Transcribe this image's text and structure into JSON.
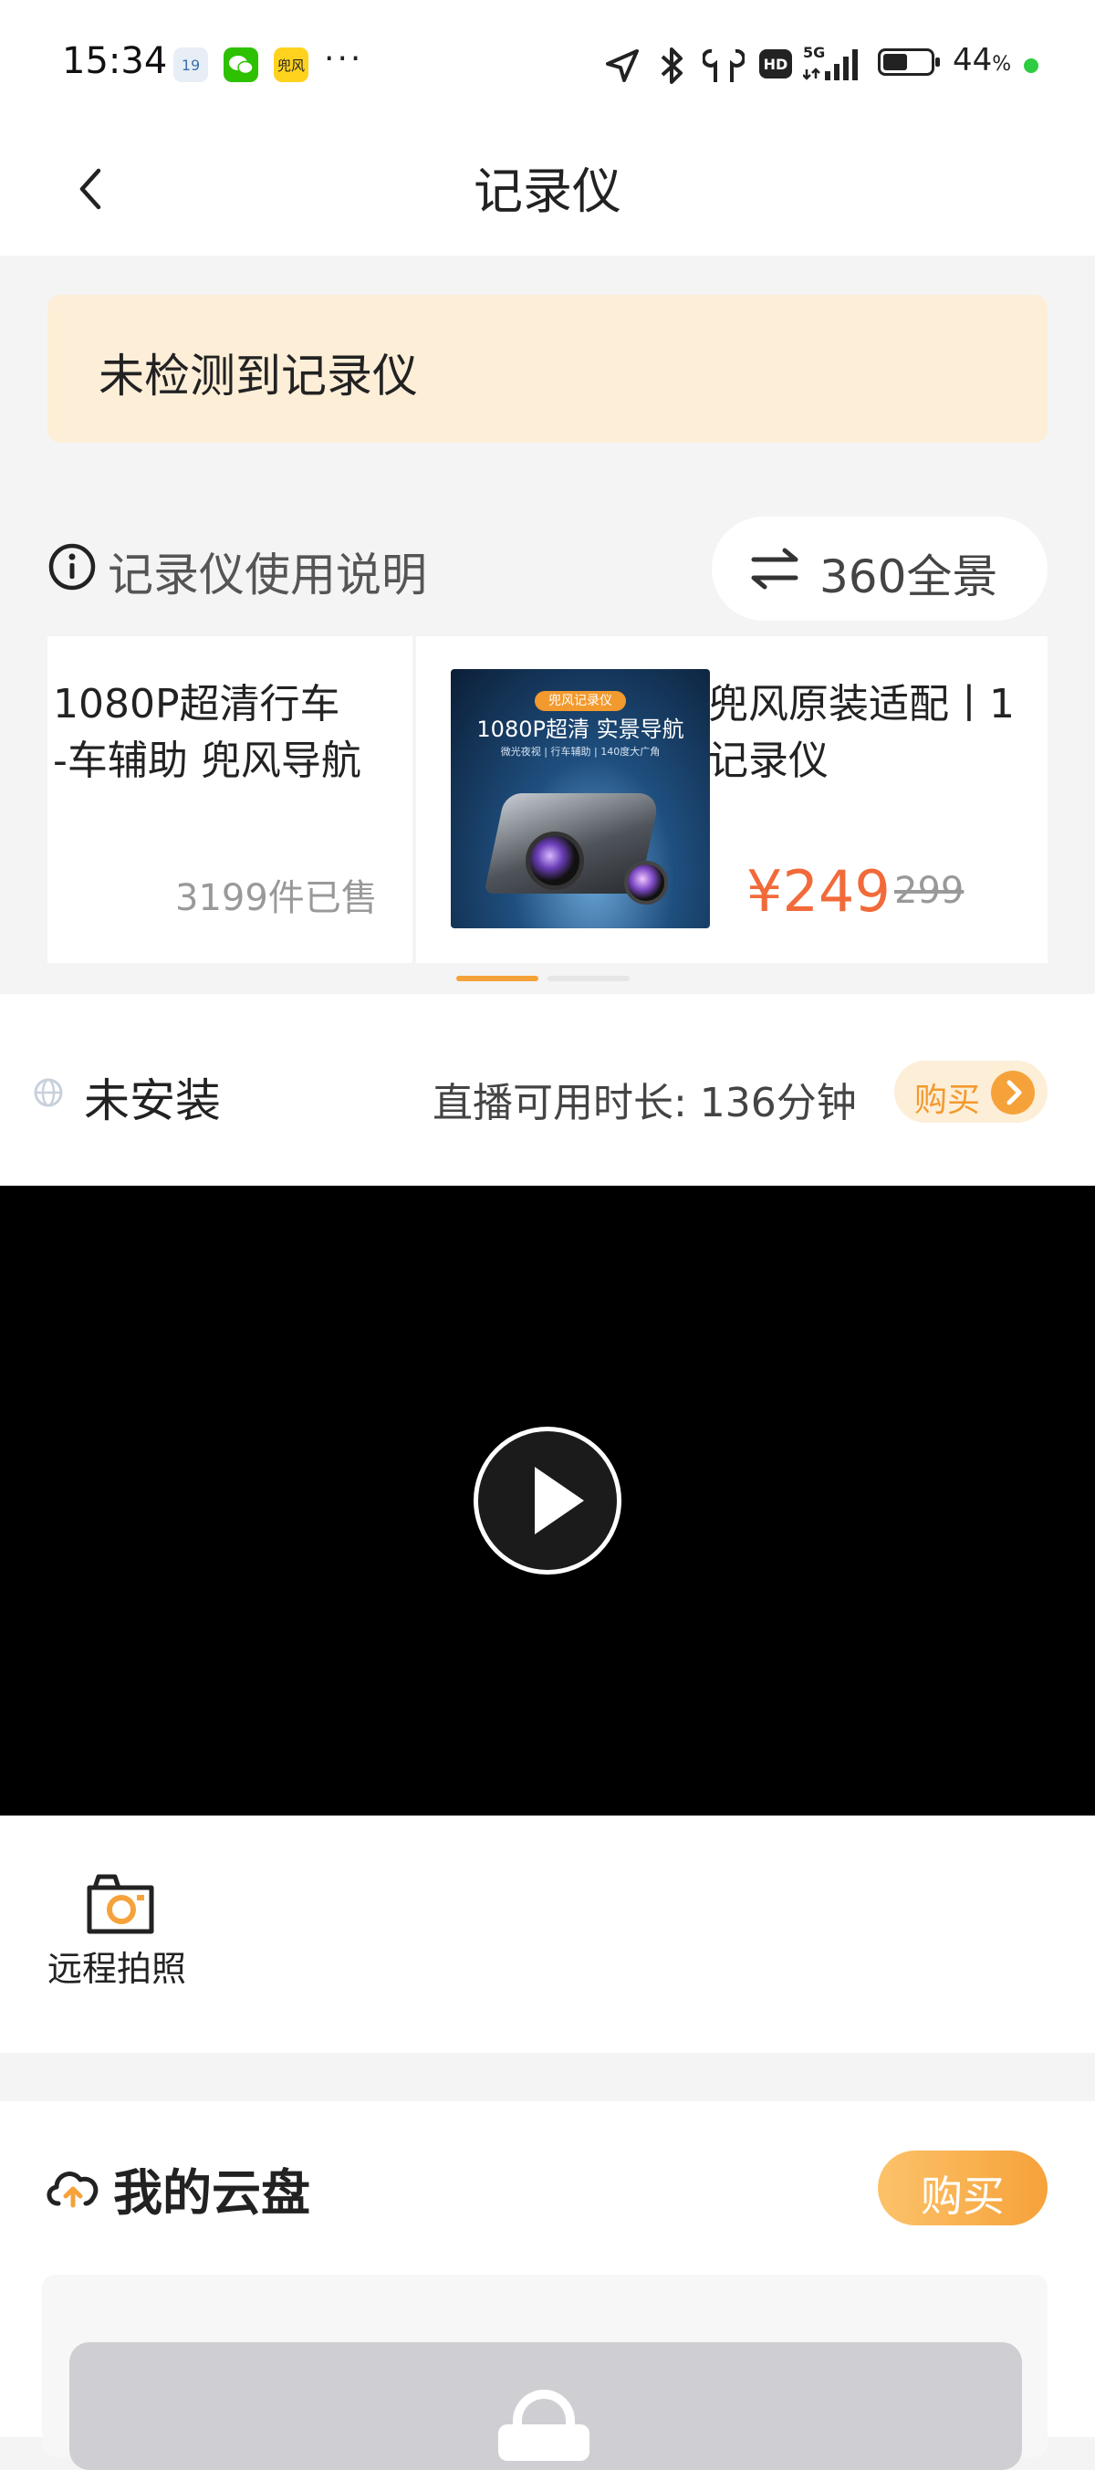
{
  "status_bar": {
    "time": "15:34",
    "app_icons": [
      "calendar-icon",
      "wechat-icon",
      "doufeng-app-icon"
    ],
    "app_icon_labels": [
      "19",
      "",
      "兜风"
    ],
    "more": "···",
    "network": "5G",
    "hd": "HD",
    "battery_percent": "44",
    "battery_unit": "%"
  },
  "nav": {
    "title": "记录仪"
  },
  "warning": {
    "text": "未检测到记录仪"
  },
  "help": {
    "label": "记录仪使用说明",
    "switch_label": "360全景"
  },
  "carousel": {
    "products": [
      {
        "title_line1": "1080P超清行车",
        "title_line2": "-车辅助 兜风导航",
        "sold": "3199件已售"
      },
      {
        "thumb_tag": "兜风记录仪",
        "thumb_headline": "1080P超清 实景导航",
        "thumb_sub": "微光夜视 | 行车辅助 | 140度大广角",
        "title_line1": "兜风原装适配丨1",
        "title_line2": "记录仪",
        "price": "¥249",
        "original_price": "299"
      }
    ],
    "active_index": 0,
    "page_count": 2
  },
  "install": {
    "status": "未安装",
    "live_duration": "直播可用时长: 136分钟",
    "buy_label": "购买"
  },
  "video": {
    "play_icon": "play-icon"
  },
  "actions": {
    "remote_photo": "远程拍照"
  },
  "cloud": {
    "title": "我的云盘",
    "buy_label": "购买"
  },
  "colors": {
    "accent_orange": "#f6a23a",
    "price_red": "#f26a3a",
    "warning_bg": "#fdeed8"
  }
}
